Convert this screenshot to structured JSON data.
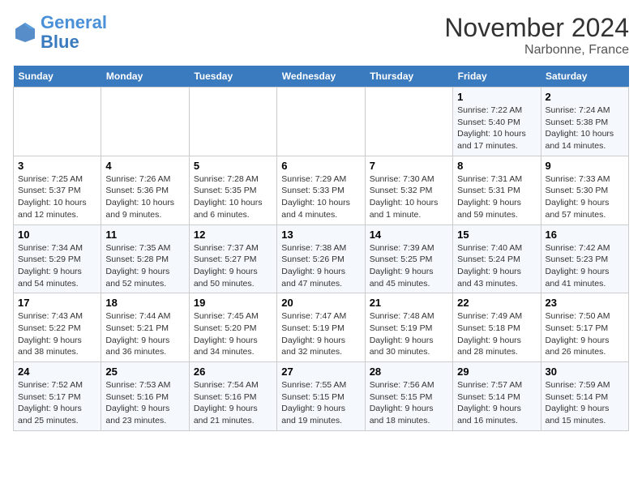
{
  "header": {
    "logo_line1": "General",
    "logo_line2": "Blue",
    "month_title": "November 2024",
    "location": "Narbonne, France"
  },
  "weekdays": [
    "Sunday",
    "Monday",
    "Tuesday",
    "Wednesday",
    "Thursday",
    "Friday",
    "Saturday"
  ],
  "weeks": [
    [
      {
        "day": "",
        "info": ""
      },
      {
        "day": "",
        "info": ""
      },
      {
        "day": "",
        "info": ""
      },
      {
        "day": "",
        "info": ""
      },
      {
        "day": "",
        "info": ""
      },
      {
        "day": "1",
        "info": "Sunrise: 7:22 AM\nSunset: 5:40 PM\nDaylight: 10 hours and 17 minutes."
      },
      {
        "day": "2",
        "info": "Sunrise: 7:24 AM\nSunset: 5:38 PM\nDaylight: 10 hours and 14 minutes."
      }
    ],
    [
      {
        "day": "3",
        "info": "Sunrise: 7:25 AM\nSunset: 5:37 PM\nDaylight: 10 hours and 12 minutes."
      },
      {
        "day": "4",
        "info": "Sunrise: 7:26 AM\nSunset: 5:36 PM\nDaylight: 10 hours and 9 minutes."
      },
      {
        "day": "5",
        "info": "Sunrise: 7:28 AM\nSunset: 5:35 PM\nDaylight: 10 hours and 6 minutes."
      },
      {
        "day": "6",
        "info": "Sunrise: 7:29 AM\nSunset: 5:33 PM\nDaylight: 10 hours and 4 minutes."
      },
      {
        "day": "7",
        "info": "Sunrise: 7:30 AM\nSunset: 5:32 PM\nDaylight: 10 hours and 1 minute."
      },
      {
        "day": "8",
        "info": "Sunrise: 7:31 AM\nSunset: 5:31 PM\nDaylight: 9 hours and 59 minutes."
      },
      {
        "day": "9",
        "info": "Sunrise: 7:33 AM\nSunset: 5:30 PM\nDaylight: 9 hours and 57 minutes."
      }
    ],
    [
      {
        "day": "10",
        "info": "Sunrise: 7:34 AM\nSunset: 5:29 PM\nDaylight: 9 hours and 54 minutes."
      },
      {
        "day": "11",
        "info": "Sunrise: 7:35 AM\nSunset: 5:28 PM\nDaylight: 9 hours and 52 minutes."
      },
      {
        "day": "12",
        "info": "Sunrise: 7:37 AM\nSunset: 5:27 PM\nDaylight: 9 hours and 50 minutes."
      },
      {
        "day": "13",
        "info": "Sunrise: 7:38 AM\nSunset: 5:26 PM\nDaylight: 9 hours and 47 minutes."
      },
      {
        "day": "14",
        "info": "Sunrise: 7:39 AM\nSunset: 5:25 PM\nDaylight: 9 hours and 45 minutes."
      },
      {
        "day": "15",
        "info": "Sunrise: 7:40 AM\nSunset: 5:24 PM\nDaylight: 9 hours and 43 minutes."
      },
      {
        "day": "16",
        "info": "Sunrise: 7:42 AM\nSunset: 5:23 PM\nDaylight: 9 hours and 41 minutes."
      }
    ],
    [
      {
        "day": "17",
        "info": "Sunrise: 7:43 AM\nSunset: 5:22 PM\nDaylight: 9 hours and 38 minutes."
      },
      {
        "day": "18",
        "info": "Sunrise: 7:44 AM\nSunset: 5:21 PM\nDaylight: 9 hours and 36 minutes."
      },
      {
        "day": "19",
        "info": "Sunrise: 7:45 AM\nSunset: 5:20 PM\nDaylight: 9 hours and 34 minutes."
      },
      {
        "day": "20",
        "info": "Sunrise: 7:47 AM\nSunset: 5:19 PM\nDaylight: 9 hours and 32 minutes."
      },
      {
        "day": "21",
        "info": "Sunrise: 7:48 AM\nSunset: 5:19 PM\nDaylight: 9 hours and 30 minutes."
      },
      {
        "day": "22",
        "info": "Sunrise: 7:49 AM\nSunset: 5:18 PM\nDaylight: 9 hours and 28 minutes."
      },
      {
        "day": "23",
        "info": "Sunrise: 7:50 AM\nSunset: 5:17 PM\nDaylight: 9 hours and 26 minutes."
      }
    ],
    [
      {
        "day": "24",
        "info": "Sunrise: 7:52 AM\nSunset: 5:17 PM\nDaylight: 9 hours and 25 minutes."
      },
      {
        "day": "25",
        "info": "Sunrise: 7:53 AM\nSunset: 5:16 PM\nDaylight: 9 hours and 23 minutes."
      },
      {
        "day": "26",
        "info": "Sunrise: 7:54 AM\nSunset: 5:16 PM\nDaylight: 9 hours and 21 minutes."
      },
      {
        "day": "27",
        "info": "Sunrise: 7:55 AM\nSunset: 5:15 PM\nDaylight: 9 hours and 19 minutes."
      },
      {
        "day": "28",
        "info": "Sunrise: 7:56 AM\nSunset: 5:15 PM\nDaylight: 9 hours and 18 minutes."
      },
      {
        "day": "29",
        "info": "Sunrise: 7:57 AM\nSunset: 5:14 PM\nDaylight: 9 hours and 16 minutes."
      },
      {
        "day": "30",
        "info": "Sunrise: 7:59 AM\nSunset: 5:14 PM\nDaylight: 9 hours and 15 minutes."
      }
    ]
  ]
}
